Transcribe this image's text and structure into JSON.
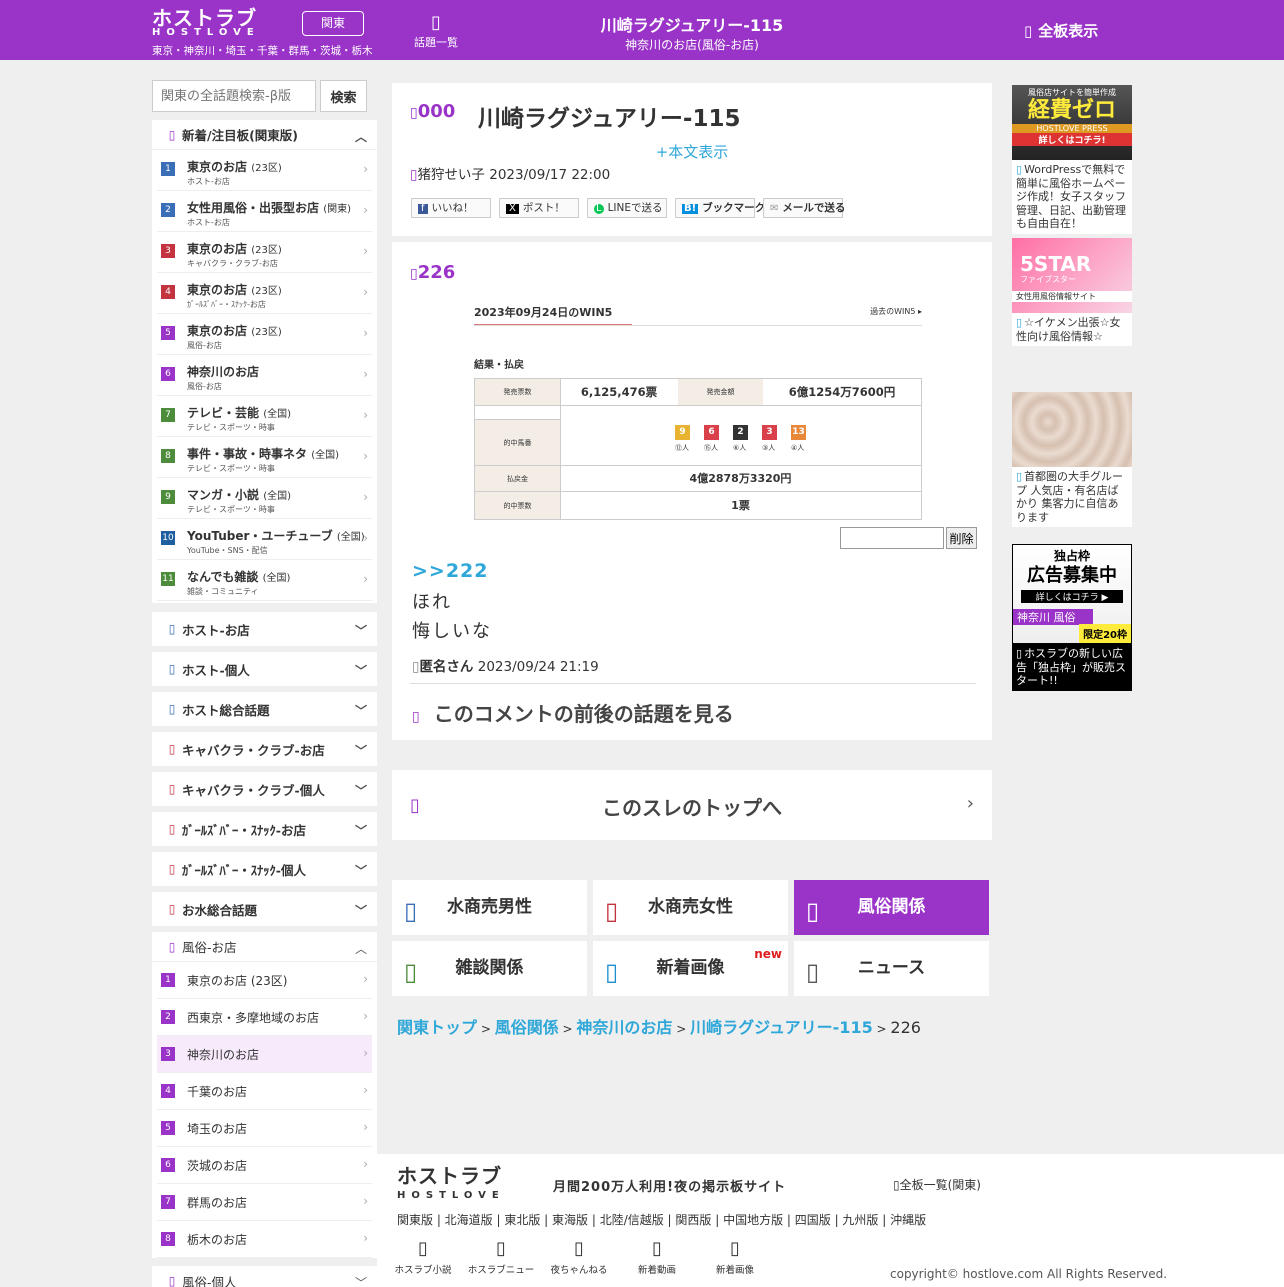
{
  "header": {
    "logo": "ホストラブ",
    "logo_sub": "HOSTLOVE",
    "region_btn": "関東",
    "areas": "東京・神奈川・埼玉・千葉・群馬・茨城・栃木",
    "topics_list": "話題一覧",
    "title": "川崎ラグジュアリー-115",
    "subtitle": "神奈川のお店(風俗-お店)",
    "all_boards": "全板表示"
  },
  "search": {
    "placeholder": "関東の全話題検索-β版",
    "button": "検索"
  },
  "sidebar": {
    "featured_title": "新着/注目板(関東版)",
    "featured": [
      {
        "n": "1",
        "name": "東京のお店",
        "tag": "(23区)",
        "sub": "ホスト-お店",
        "color": "#3a6fb8"
      },
      {
        "n": "2",
        "name": "女性用風俗・出張型お店",
        "tag": "(関東)",
        "sub": "ホスト-お店",
        "color": "#3a6fb8"
      },
      {
        "n": "3",
        "name": "東京のお店",
        "tag": "(23区)",
        "sub": "キャバクラ・クラブ-お店",
        "color": "#c33340"
      },
      {
        "n": "4",
        "name": "東京のお店",
        "tag": "(23区)",
        "sub": "ｶﾞｰﾙｽﾞﾊﾞｰ・ｽﾅｯｸ-お店",
        "color": "#c33340"
      },
      {
        "n": "5",
        "name": "東京のお店",
        "tag": "(23区)",
        "sub": "風俗-お店",
        "color": "#9a33c8"
      },
      {
        "n": "6",
        "name": "神奈川のお店",
        "tag": "",
        "sub": "風俗-お店",
        "color": "#9a33c8"
      },
      {
        "n": "7",
        "name": "テレビ・芸能",
        "tag": "(全国)",
        "sub": "テレビ・スポーツ・時事",
        "color": "#4d8c3a"
      },
      {
        "n": "8",
        "name": "事件・事故・時事ネタ",
        "tag": "(全国)",
        "sub": "テレビ・スポーツ・時事",
        "color": "#4d8c3a"
      },
      {
        "n": "9",
        "name": "マンガ・小説",
        "tag": "(全国)",
        "sub": "テレビ・スポーツ・時事",
        "color": "#4d8c3a"
      },
      {
        "n": "10",
        "name": "YouTuber・ユーチューブ",
        "tag": "(全国)",
        "sub": "YouTube・SNS・配信",
        "color": "#1f5fa0"
      },
      {
        "n": "11",
        "name": "なんでも雑談",
        "tag": "(全国)",
        "sub": "雑談・コミュニティ",
        "color": "#4d8c3a"
      }
    ],
    "sections": [
      {
        "label": "ホスト-お店",
        "color": "#3a6fb8"
      },
      {
        "label": "ホスト-個人",
        "color": "#3a6fb8"
      },
      {
        "label": "ホスト総合話題",
        "color": "#3a6fb8"
      },
      {
        "label": "キャバクラ・クラブ-お店",
        "color": "#c33340"
      },
      {
        "label": "キャバクラ・クラブ-個人",
        "color": "#c33340"
      },
      {
        "label": "ｶﾞｰﾙｽﾞﾊﾞｰ・ｽﾅｯｸ-お店",
        "color": "#c33340"
      },
      {
        "label": "ｶﾞｰﾙｽﾞﾊﾞｰ・ｽﾅｯｸ-個人",
        "color": "#c33340"
      },
      {
        "label": "お水総合話題",
        "color": "#c33340"
      }
    ],
    "fuzoku_title": "風俗-お店",
    "fuzoku": [
      "東京のお店 (23区)",
      "西東京・多摩地域のお店",
      "神奈川のお店",
      "千葉のお店",
      "埼玉のお店",
      "茨城のお店",
      "群馬のお店",
      "栃木のお店"
    ],
    "fuzoku_active": "3",
    "last_section": "風俗-個人"
  },
  "thread": {
    "num": "000",
    "title": "川崎ラグジュアリー-115",
    "show_body": "+本文表示",
    "author": "猪狩せい子",
    "date": "2023/09/17 22:00",
    "share": [
      "いいね！",
      "ポスト！",
      "LINEで送る",
      "ブックマーク",
      "メールで送る"
    ]
  },
  "post": {
    "num": "226",
    "image": {
      "title": "2023年09月24日のWIN5",
      "past": "過去のWIN5 ▸",
      "section": "結果・払戻",
      "sales_label": "発売票数",
      "sales": "6,125,476票",
      "amount_label": "発売金額",
      "amount": "6億1254万7600円",
      "win_label": "的中馬番",
      "horses": [
        "9",
        "6",
        "2",
        "3",
        "13"
      ],
      "pops": [
        "⑫人",
        "⑮人",
        "⑥人",
        "③人",
        "④人"
      ],
      "pay_label": "払戻金",
      "pay": "4億2878万3320円",
      "count_label": "的中票数",
      "count": "1票"
    },
    "delete": "削除",
    "anchor": ">>222",
    "body1": "ほれ",
    "body2": "悔しいな",
    "author": "匿名さん",
    "date": "2023/09/24 21:19",
    "context": "このコメントの前後の話題を見る"
  },
  "to_top": "このスレのトップへ",
  "categories": [
    {
      "label": "水商売男性",
      "color": "#3a6fb8"
    },
    {
      "label": "水商売女性",
      "color": "#c33340"
    },
    {
      "label": "風俗関係",
      "color": "#9a33c8"
    },
    {
      "label": "雑談関係",
      "color": "#4d8c3a"
    },
    {
      "label": "新着画像",
      "color": "#1f8fd0",
      "badge": "new"
    },
    {
      "label": "ニュース",
      "color": "#555555"
    }
  ],
  "breadcrumb": [
    "関東トップ",
    "風俗関係",
    "神奈川のお店",
    "川崎ラグジュアリー-115",
    "226"
  ],
  "ads": [
    {
      "img_lines": [
        "風俗店サイトを簡単作成",
        "経費ゼロ",
        "HOSTLOVE PRESS",
        "詳しくはコチラ!"
      ],
      "text": "WordPressで無料で簡単に風俗ホームページ作成！女子スタッフ管理、日記、出勤管理も自由自在！"
    },
    {
      "img_lines": [
        "5STAR",
        "ファイブスター",
        "女性用風俗情報サイト"
      ],
      "text": "☆イケメン出張☆女性向け風俗情報☆"
    },
    {
      "img_lines": [],
      "text": "首都圏の大手グループ 人気店・有名店ばかり 集客力に自信あります"
    },
    {
      "img_lines": [
        "独占枠",
        "広告募集中",
        "詳しくはコチラ ▶",
        "神奈川 風俗",
        "限定20枠"
      ],
      "text": "ホスラブの新しい広告「独占枠」が販売スタート!!"
    }
  ],
  "footer": {
    "logo": "ホストラブ",
    "logo_sub": "HOSTLOVE",
    "tagline": "月間200万人利用!夜の掲示板サイト",
    "all": "全板一覧(関東)",
    "regions": "関東版 | 北海道版 | 東北版 | 東海版 | 北陸/信越版 | 関西版 | 中国地方版 | 四国版 | 九州版 | 沖縄版",
    "links": [
      "ホスラブ小説",
      "ホスラブニュー",
      "夜ちゃんねる",
      "新着動画",
      "新着画像"
    ],
    "copyright": "copyright© hostlove.com All Rights Reserved."
  },
  "colors": {
    "brand": "#9a33c8",
    "link": "#2fa7d8"
  }
}
